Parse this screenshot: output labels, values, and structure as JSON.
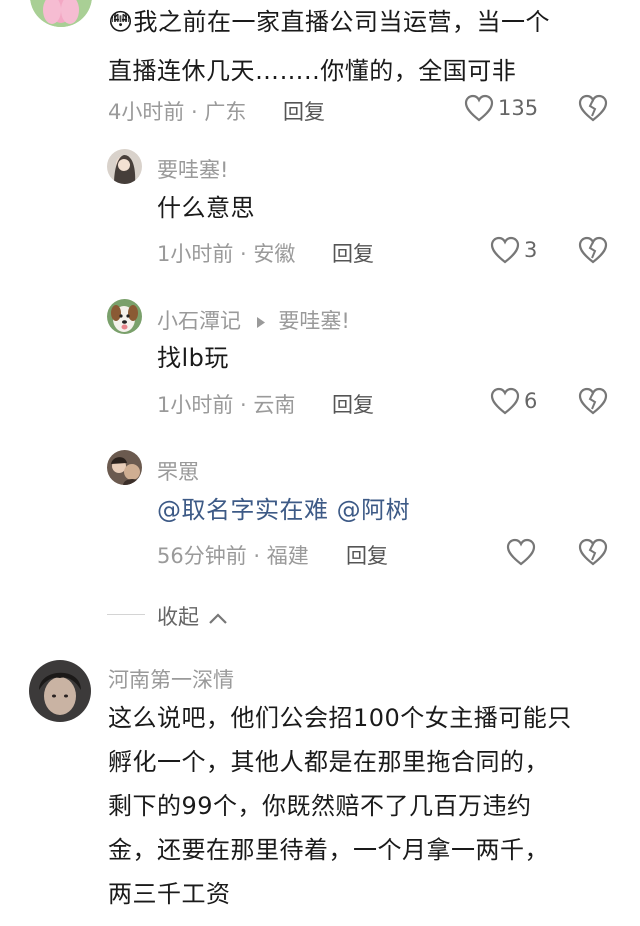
{
  "comments": [
    {
      "emoji": "😳",
      "text_lines": [
        "我之前在一家直播公司当运营，当一个",
        "直播连休几天……..你懂的，全国可非"
      ],
      "meta": "4小时前 · 广东",
      "reply_label": "回复",
      "likes": "135"
    },
    {
      "username": "要哇塞!",
      "text": "什么意思",
      "meta": "1小时前 · 安徽",
      "reply_label": "回复",
      "likes": "3"
    },
    {
      "username": "小石潭记",
      "reply_to": "要哇塞!",
      "text": "找lb玩",
      "meta": "1小时前 · 云南",
      "reply_label": "回复",
      "likes": "6"
    },
    {
      "username": "罘罳",
      "mentions": "@取名字实在难 @阿树",
      "meta": "56分钟前 · 福建",
      "reply_label": "回复",
      "likes": ""
    },
    {
      "username": "河南第一深情",
      "text_lines": [
        "这么说吧，他们公会招100个女主播可能只",
        "孵化一个，其他人都是在那里拖合同的，",
        "剩下的99个，你既然赔不了几百万违约",
        "金，还要在那里待着，一个月拿一两千，",
        "两三千工资"
      ]
    }
  ],
  "collapse_label": "收起",
  "icons": {
    "like": "heart-outline-icon",
    "dislike": "broken-heart-icon",
    "collapse": "chevron-up-icon",
    "reply_arrow": "triangle-right-icon"
  },
  "colors": {
    "meta": "#9a9a9a",
    "mention": "#3d5a86"
  }
}
